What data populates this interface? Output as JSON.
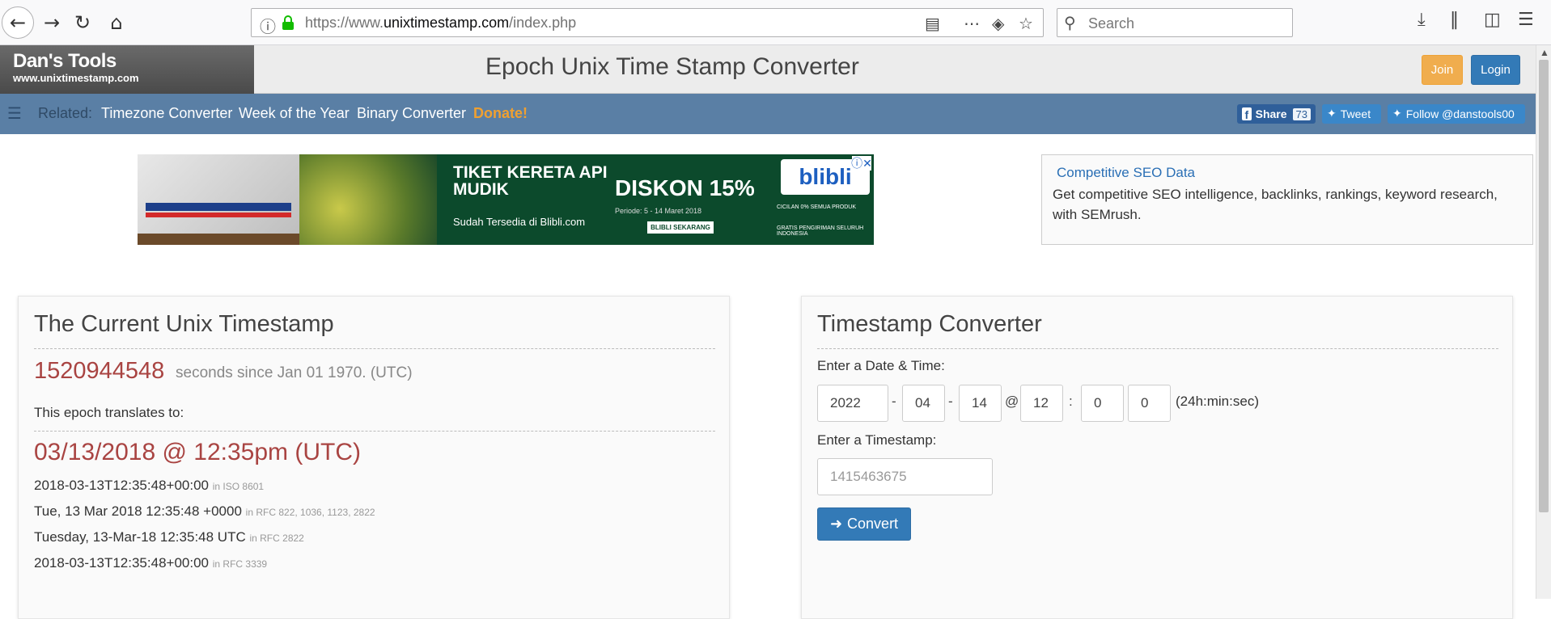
{
  "browser": {
    "url_host": "https://www.",
    "url_domain": "unixtimestamp.com",
    "url_path": "/index.php",
    "search_placeholder": "Search"
  },
  "header": {
    "logo_title": "Dan's Tools",
    "logo_sub": "www.unixtimestamp.com",
    "title": "Epoch Unix Time Stamp Converter",
    "join_label": "Join",
    "login_label": "Login"
  },
  "related": {
    "label": "Related:",
    "links": [
      "Timezone Converter",
      "Week of the Year",
      "Binary Converter"
    ],
    "donate": "Donate!",
    "share_label": "Share",
    "share_count": "73",
    "tweet_label": "Tweet",
    "follow_label": "Follow @danstools00"
  },
  "ad": {
    "headline": "TIKET KERETA API MUDIK",
    "sub": "Sudah Tersedia di Blibli.com",
    "discount": "DISKON 15%",
    "period": "Periode: 5 - 14 Maret 2018",
    "cta": "BLIBLI SEKARANG",
    "brand": "blibli",
    "feature1": "CICILAN 0% SEMUA PRODUK",
    "feature2": "GRATIS PENGIRIMAN SELURUH INDONESIA"
  },
  "seo": {
    "title": "Competitive SEO Data",
    "body": "Get competitive SEO intelligence, backlinks, rankings, keyword research, with SEMrush."
  },
  "current": {
    "title": "The Current Unix Timestamp",
    "timestamp": "1520944548",
    "timestamp_tail": "seconds since Jan 01 1970. (UTC)",
    "epoch_label": "This epoch translates to:",
    "date_big": "03/13/2018 @ 12:35pm (UTC)",
    "formats": [
      {
        "value": "2018-03-13T12:35:48+00:00",
        "note": "in ISO 8601"
      },
      {
        "value": "Tue, 13 Mar 2018 12:35:48 +0000",
        "note": "in RFC 822, 1036, 1123, 2822"
      },
      {
        "value": "Tuesday, 13-Mar-18 12:35:48 UTC",
        "note": "in RFC 2822"
      },
      {
        "value": "2018-03-13T12:35:48+00:00",
        "note": "in RFC 3339"
      }
    ]
  },
  "converter": {
    "title": "Timestamp Converter",
    "date_label": "Enter a Date & Time:",
    "year": "2022",
    "month": "04",
    "day": "14",
    "hour": "12",
    "minute": "0",
    "second": "0",
    "sep_dash": "-",
    "sep_at": "@",
    "sep_colon": ":",
    "time_hint": "(24h:min:sec)",
    "ts_label": "Enter a Timestamp:",
    "ts_placeholder": "1415463675",
    "convert_label": "Convert"
  }
}
